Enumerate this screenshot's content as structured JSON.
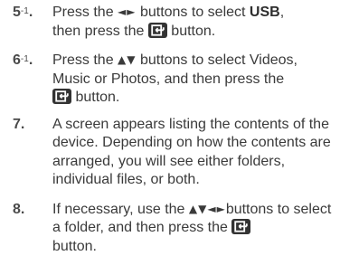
{
  "steps": [
    {
      "number": "5",
      "sub": "-1",
      "suffix": ".",
      "parts": {
        "a": "Press the ",
        "arrows": "◄►",
        "b": " buttons to select ",
        "bold": "USB",
        "c": ",",
        "d": "then press the ",
        "icon": "enter-button-icon",
        "e": " button."
      }
    },
    {
      "number": "6",
      "sub": "-1",
      "suffix": ".",
      "parts": {
        "a": "Press the ",
        "arrows": "▲▼",
        "b": " buttons to select Videos,",
        "c": "Music or Photos, and then press the",
        "icon": "enter-button-icon",
        "d": " button."
      }
    },
    {
      "number": "7.",
      "text": "A screen appears listing the contents of the device. Depending on how the contents are arranged, you will see either folders, individual files, or both."
    },
    {
      "number": "8.",
      "parts": {
        "a": "If necessary, use the ",
        "arrows": "▲▼◄►",
        "b": "buttons to select a folder, and then press the ",
        "icon": "enter-button-icon",
        "c": "button."
      }
    }
  ]
}
